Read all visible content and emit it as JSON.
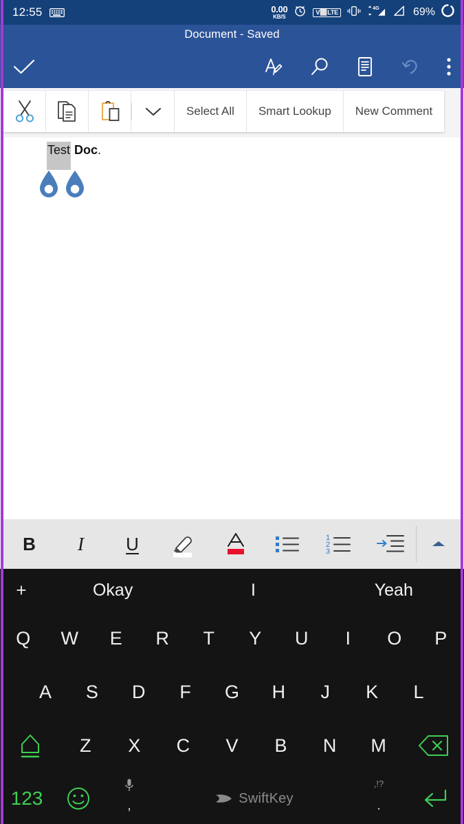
{
  "colors": {
    "status_bar_bg": "#15417a",
    "app_bar_bg": "#2b5397",
    "accent_purple_edge": "#a23ad6",
    "keyboard_bg": "#141414",
    "keyboard_accent_green": "#3ecf53",
    "format_bar_bg": "#e6e6e6",
    "selection_highlight": "#c6c6c6",
    "selection_handle": "#4a7ebb",
    "font_color_swatch": "#e8112d"
  },
  "status_bar": {
    "time": "12:55",
    "keyboard_icon": "keyboard-icon",
    "network_speed_value": "0.00",
    "network_speed_unit": "KB/S",
    "alarm_icon": "alarm-clock-icon",
    "volte_label": "V⬜LTE",
    "volte_text": "VoLTE",
    "vibrate_icon": "vibrate-icon",
    "data_icon": "mobile-data-4g-icon",
    "data_label": "4G",
    "signal_icon": "signal-bar-icon",
    "battery_percent": "69%",
    "battery_icon": "battery-charging-circle-icon"
  },
  "app_bar": {
    "document_title": "Document - Saved",
    "confirm_icon": "checkmark-icon",
    "actions": [
      {
        "name": "ink-draw-icon",
        "label": "Draw"
      },
      {
        "name": "search-icon",
        "label": "Find"
      },
      {
        "name": "reading-view-icon",
        "label": "Mobile View"
      },
      {
        "name": "undo-icon",
        "label": "Undo"
      },
      {
        "name": "overflow-menu-icon",
        "label": "More options"
      }
    ]
  },
  "context_toolbar": {
    "cut_label": "Cut",
    "copy_label": "Copy",
    "paste_label": "Paste",
    "expand_label": "More",
    "select_all_label": "Select All",
    "smart_lookup_label": "Smart Lookup",
    "new_comment_label": "New Comment"
  },
  "document": {
    "selected_text": "Test",
    "remaining_text_bold": "Doc",
    "remaining_text_tail": ".",
    "full_text": "Test Doc.",
    "start_handle": "selection-handle-start",
    "end_handle": "selection-handle-end"
  },
  "format_toolbar": {
    "bold_label": "B",
    "italic_label": "I",
    "underline_label": "U",
    "highlight_label": "Highlight",
    "font_color_label": "A",
    "bullet_list_label": "Bullets",
    "numbered_list_label": "Numbering",
    "numbered_list_digits": [
      "1",
      "2",
      "3"
    ],
    "indent_label": "Increase Indent",
    "collapse_label": "Collapse ribbon"
  },
  "keyboard": {
    "add_suggestion": "+",
    "suggestions": [
      "Okay",
      "I",
      "Yeah"
    ],
    "row1": [
      "Q",
      "W",
      "E",
      "R",
      "T",
      "Y",
      "U",
      "I",
      "O",
      "P"
    ],
    "row2": [
      "A",
      "S",
      "D",
      "F",
      "G",
      "H",
      "J",
      "K",
      "L"
    ],
    "row3": [
      "Z",
      "X",
      "C",
      "V",
      "B",
      "N",
      "M"
    ],
    "shift_label": "shift-key-icon",
    "backspace_label": "backspace-key-icon",
    "numbers_label": "123",
    "emoji_label": "emoji-key-icon",
    "mic_label": "microphone-icon",
    "comma_label": ",",
    "space_brand": "SwiftKey",
    "punctuation_hint": ",!?",
    "period_label": ".",
    "enter_label": "enter-key-icon"
  }
}
